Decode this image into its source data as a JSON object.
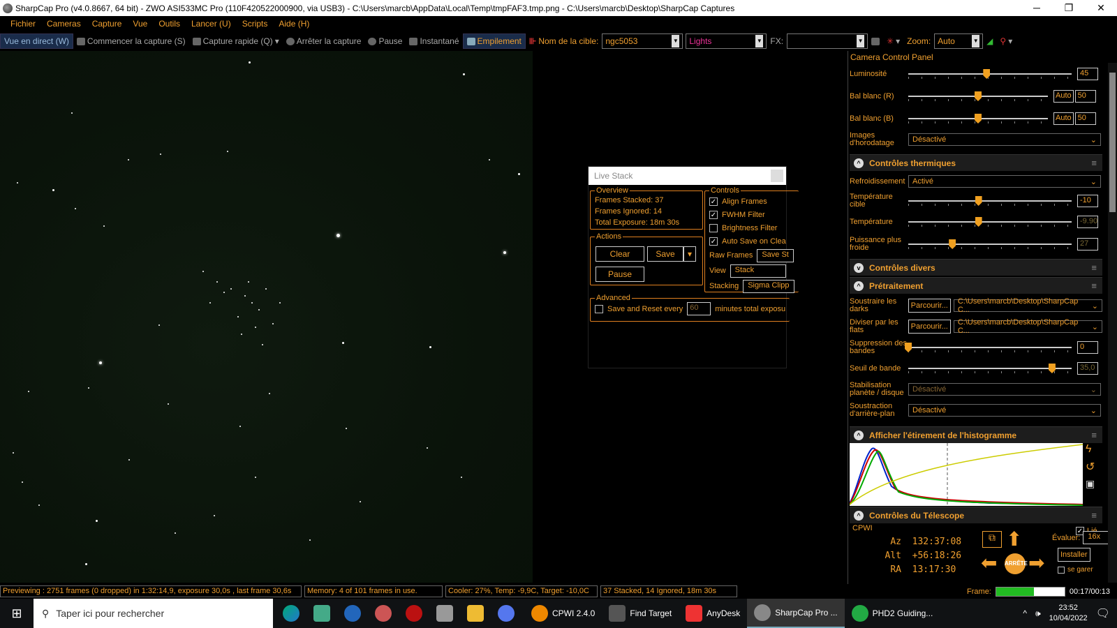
{
  "window": {
    "title": "SharpCap Pro (v4.0.8667, 64 bit) - ZWO ASI533MC Pro (110F420522000900, via USB3) - C:\\Users\\marcb\\AppData\\Local\\Temp\\tmpFAF3.tmp.png - C:\\Users\\marcb\\Desktop\\SharpCap Captures",
    "minimize": "─",
    "maximize": "❐",
    "close": "✕"
  },
  "menu": [
    "Fichier",
    "Cameras",
    "Capture",
    "Vue",
    "Outils",
    "Lancer (U)",
    "Scripts",
    "Aide (H)"
  ],
  "toolbar": {
    "live_view": "Vue en direct (W)",
    "start_capture": "Commencer la capture (S)",
    "quick_capture": "Capture rapide (Q)",
    "stop_capture": "Arrêter la capture",
    "pause": "Pause",
    "snapshot": "Instantané",
    "stacking": "Empilement",
    "target_label": "Nom de la cible:",
    "target_value": "ngc5053",
    "frame_type": "Lights",
    "fx_label": "FX:",
    "fx_value": "",
    "zoom_label": "Zoom:",
    "zoom_value": "Auto"
  },
  "live_stack": {
    "title": "Live Stack",
    "overview_label": "Overview",
    "frames_stacked": "Frames Stacked: 37",
    "frames_ignored": "Frames Ignored: 14",
    "total_exposure": "Total Exposure:   18m 30s",
    "actions_label": "Actions",
    "clear": "Clear",
    "save": "Save",
    "pause": "Pause",
    "controls_label": "Controls",
    "align_frames": "Align Frames",
    "fwhm_filter": "FWHM Filter",
    "brightness_filter": "Brightness Filter",
    "auto_save": "Auto Save on Clea",
    "raw_frames_label": "Raw Frames",
    "raw_frames_value": "Save St",
    "view_label": "View",
    "view_value": "Stack",
    "stacking_label": "Stacking",
    "stacking_value": "Sigma Clipp",
    "advanced_label": "Advanced",
    "save_reset": "Save and Reset every",
    "save_reset_minutes": "60",
    "minutes_total": "minutes total exposu",
    "checks": {
      "align": true,
      "fwhm": true,
      "brightness": false,
      "autosave": true,
      "save_reset": false
    }
  },
  "panel": {
    "title": "Camera Control Panel",
    "luminosite": {
      "label": "Luminosité",
      "value": "45",
      "level": 0.48
    },
    "bal_r": {
      "label": "Bal blanc (R)",
      "value": "50",
      "auto": "Auto",
      "level": 0.5
    },
    "bal_b": {
      "label": "Bal blanc (B)",
      "value": "50",
      "auto": "Auto",
      "level": 0.5
    },
    "horodatage": {
      "label": "Images d'horodatage",
      "value": "Désactivé"
    },
    "thermal_section": "Contrôles thermiques",
    "refroid": {
      "label": "Refroidissement",
      "value": "Activé"
    },
    "temp_cible": {
      "label": "Température cible",
      "value": "-10",
      "level": 0.43
    },
    "temperature": {
      "label": "Température",
      "value": "-9.90",
      "level": 0.43
    },
    "puissance": {
      "label": "Puissance plus froide",
      "value": "27",
      "level": 0.27
    },
    "divers_section": "Contrôles divers",
    "pretrait_section": "Prétraitement",
    "darks": {
      "label": "Soustraire les darks",
      "browse": "Parcourir...",
      "path": "C:\\Users\\marcb\\Desktop\\SharpCap C..."
    },
    "flats": {
      "label": "Diviser par les flats",
      "browse": "Parcourir...",
      "path": "C:\\Users\\marcb\\Desktop\\SharpCap C..."
    },
    "bandes": {
      "label": "Suppression des bandes",
      "value": "0",
      "level": 0.0
    },
    "seuil": {
      "label": "Seuil de bande",
      "value": "35,0",
      "level": 0.88
    },
    "stab": {
      "label": "Stabilisation planète / disque",
      "value": "Désactivé"
    },
    "arriere": {
      "label": "Soustraction d'arrière-plan",
      "value": "Désactivé"
    },
    "histo_section": "Afficher l'étirement de l'histogramme",
    "telescope_section": "Contrôles du Télescope",
    "mount": "CPWI",
    "linked": "Lié",
    "az_label": "Az",
    "az": "132:37:08",
    "alt_label": "Alt",
    "alt": "+56:18:26",
    "ra_label": "RA",
    "ra": "13:17:30",
    "evaluer": "Évaluer:",
    "speed": "16x",
    "installer": "Installer",
    "park": "se garer",
    "stop_btn": "ARRÊTE",
    "frame_label": "Frame:",
    "frame_time": "00:17/00:13",
    "frame_progress": 0.55
  },
  "status": {
    "preview": "Previewing : 2751 frames (0 dropped) in 1:32:14,9, exposure 30,0s , last frame 30,6s",
    "memory": "Memory: 4 of 101 frames in use.",
    "cooler": "Cooler: 27%, Temp: -9,9C, Target: -10,0C",
    "stack": "37 Stacked, 14 Ignored, 18m 30s"
  },
  "taskbar": {
    "search": "Taper ici pour rechercher",
    "apps": [
      "CPWI 2.4.0",
      "Find Target",
      "AnyDesk",
      "SharpCap Pro ...",
      "PHD2 Guiding..."
    ],
    "time": "23:52",
    "date": "10/04/2022"
  },
  "colors": {
    "accent": "#f0a030",
    "selected": "#1a2c4a"
  }
}
